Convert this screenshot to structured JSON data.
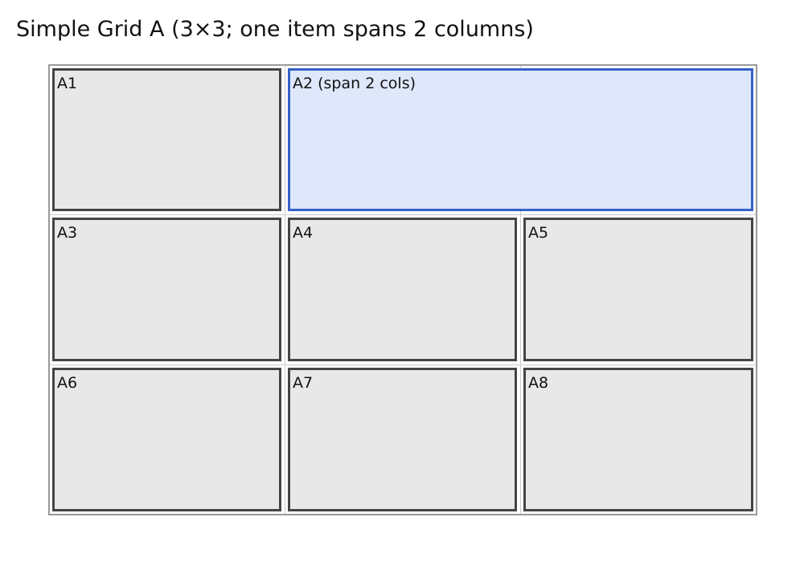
{
  "page": {
    "title": "Simple Grid A (3×3; one item spans 2 columns)"
  },
  "grid": {
    "rows": 3,
    "columns": 3,
    "items": [
      {
        "id": "A1",
        "label": "A1",
        "row": 1,
        "col": 1,
        "span": 1
      },
      {
        "id": "A2",
        "label": "A2 (span 2 cols)",
        "row": 1,
        "col": 2,
        "span": 2
      },
      {
        "id": "A3",
        "label": "A3",
        "row": 2,
        "col": 1,
        "span": 1
      },
      {
        "id": "A4",
        "label": "A4",
        "row": 2,
        "col": 2,
        "span": 1
      },
      {
        "id": "A5",
        "label": "A5",
        "row": 2,
        "col": 3,
        "span": 1
      },
      {
        "id": "A6",
        "label": "A6",
        "row": 3,
        "col": 1,
        "span": 1
      },
      {
        "id": "A7",
        "label": "A7",
        "row": 3,
        "col": 2,
        "span": 1
      },
      {
        "id": "A8",
        "label": "A8",
        "row": 3,
        "col": 3,
        "span": 1
      }
    ]
  },
  "colors": {
    "cell_fill": "#e8e8e8",
    "cell_border": "#444444",
    "span_fill": "#dfe7fb",
    "span_border": "#3461c7",
    "frame_border": "#999999"
  }
}
